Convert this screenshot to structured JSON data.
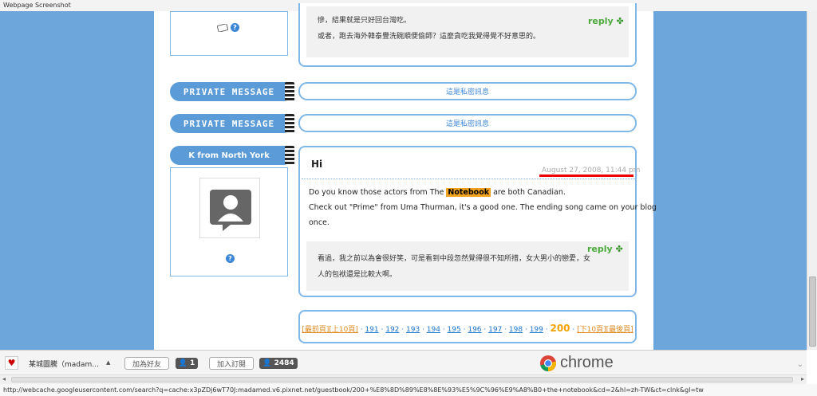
{
  "window": {
    "title": "Webpage Screenshot"
  },
  "comment_top": {
    "reply_label": "reply",
    "line1": "慘，結果就是只好回台灣吃。",
    "line2": "或者，跑去海外韓泰豐洗碗順便偷師？這麼貪吃我覺得覺不好意思的。"
  },
  "private_messages": [
    {
      "label": "PRIVATE MESSAGE",
      "text": "這是私密訊息"
    },
    {
      "label": "PRIVATE MESSAGE",
      "text": "這是私密訊息"
    }
  ],
  "post": {
    "author": "K from North York",
    "title": "Hi",
    "date": "August 27, 2008, 11:44 pm",
    "line1_pre": "Do you know those actors from The ",
    "highlight": "Notebook",
    "line1_post": " are both Canadian.",
    "line2": "Check out \"Prime\" from Uma Thurman, it's a good one. The ending song came on your blog",
    "line3": "once.",
    "reply_label": "reply",
    "reply_line1": "看過，我之前以為會很好笑，可是看到中段忽然覺得很不知所措，女大男小的戀愛，女",
    "reply_line2": "人的包袱還是比較大啊。"
  },
  "pager": {
    "first": "[最前頁]",
    "prev10": "[上10頁]",
    "pages": [
      "191",
      "192",
      "193",
      "194",
      "195",
      "196",
      "197",
      "198",
      "199"
    ],
    "current": "200",
    "next10": "[下10頁]",
    "last": "[最後頁]"
  },
  "toolbar": {
    "site_name": "某城圖騰（madam...",
    "add_friend": "加為好友",
    "friend_count": "1",
    "subscribe": "加入訂閱",
    "subscriber_count": "2484",
    "chrome_label": "chrome"
  },
  "status_url": "http://webcache.googleusercontent.com/search?q=cache:x3pZDj6wT70J:madamed.v6.pixnet.net/guestbook/200+%E8%8D%89%E8%8E%93%E5%9C%96%E9%A8%B0+the+notebook&cd=2&hl=zh-TW&ct=clnk&gl=tw",
  "colors": {
    "accent": "#5a9bd8",
    "background": "#6da6db",
    "highlight": "#f2a21e",
    "reply_green": "#4caa3c"
  }
}
